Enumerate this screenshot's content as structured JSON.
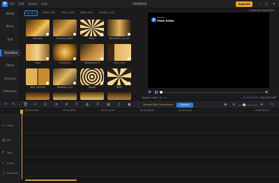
{
  "window": {
    "title": "Untitled",
    "upgrade_label": "Upgrade",
    "minimize": "—",
    "maximize": "▢",
    "close": "✕"
  },
  "menu": [
    "File",
    "Edit",
    "Export",
    "Help"
  ],
  "sidebar": {
    "items": [
      {
        "label": "Media",
        "active": false
      },
      {
        "label": "Music",
        "active": false
      },
      {
        "label": "Text",
        "active": false
      },
      {
        "label": "Transition",
        "active": true
      },
      {
        "label": "Filters",
        "active": false
      },
      {
        "label": "Overlays",
        "active": false
      },
      {
        "label": "Elements",
        "active": false
      }
    ]
  },
  "media": {
    "filter_tabs": [
      {
        "label": "All (91)",
        "active": true
      },
      {
        "label": "Basic (16)",
        "active": false
      },
      {
        "label": "Fresh (16)",
        "active": false
      },
      {
        "label": "Wipe (10)",
        "active": false
      },
      {
        "label": "Shutter (15)",
        "active": false
      }
    ],
    "thumbnails": [
      {
        "label": "Dissolve"
      },
      {
        "label": "Dissolve_Black"
      },
      {
        "label": "Rose"
      },
      {
        "label": "BandSlid_Cut_50"
      },
      {
        "label": "Clear"
      },
      {
        "label": "Central_in"
      },
      {
        "label": "Dashboard In"
      },
      {
        "label": "Push_Left"
      },
      {
        "label": "Split_Vertical"
      },
      {
        "label": "BandSlid_Out"
      },
      {
        "label": "Ripple"
      },
      {
        "label": "Whirl"
      },
      {
        "label": ""
      },
      {
        "label": ""
      },
      {
        "label": ""
      },
      {
        "label": ""
      }
    ]
  },
  "preview": {
    "aspect_note": "☐ Recently saved 16:9",
    "watermark_line1": "Powered",
    "watermark_line2": "Video Editor",
    "progress": 0.0,
    "aspect_ratio_label": "Aspect ratio:",
    "aspect_ratio_value": "16 : 9",
    "timecode_current": "00:00:00:00",
    "timecode_total": "/ 00:00:00:00"
  },
  "toolbar": {
    "speech_to_text": "Speech/Text Conversion",
    "export_label": "Export",
    "icons": [
      "undo-icon",
      "redo-icon",
      "delete-icon",
      "cut-icon",
      "crop-icon",
      "speed-icon",
      "freeze-icon",
      "text-icon",
      "color-icon",
      "duration-icon",
      "mosaic-icon",
      "pin-icon",
      "zoom-out-icon",
      "zoom-in-icon"
    ]
  },
  "timeline": {
    "ruler_ticks": [
      "00:00:00:00",
      "00:00:06:00",
      "00:00:12:00",
      "00:00:18:00",
      "00:00:24:00",
      "00:00:30:00"
    ],
    "tracks": [
      {
        "icon": "▭",
        "name": "Video"
      },
      {
        "icon": "▤",
        "name": "PIP"
      },
      {
        "icon": "T",
        "name": "Text"
      },
      {
        "icon": "♪",
        "name": "Audio"
      },
      {
        "icon": "♫",
        "name": "Narration"
      }
    ]
  }
}
